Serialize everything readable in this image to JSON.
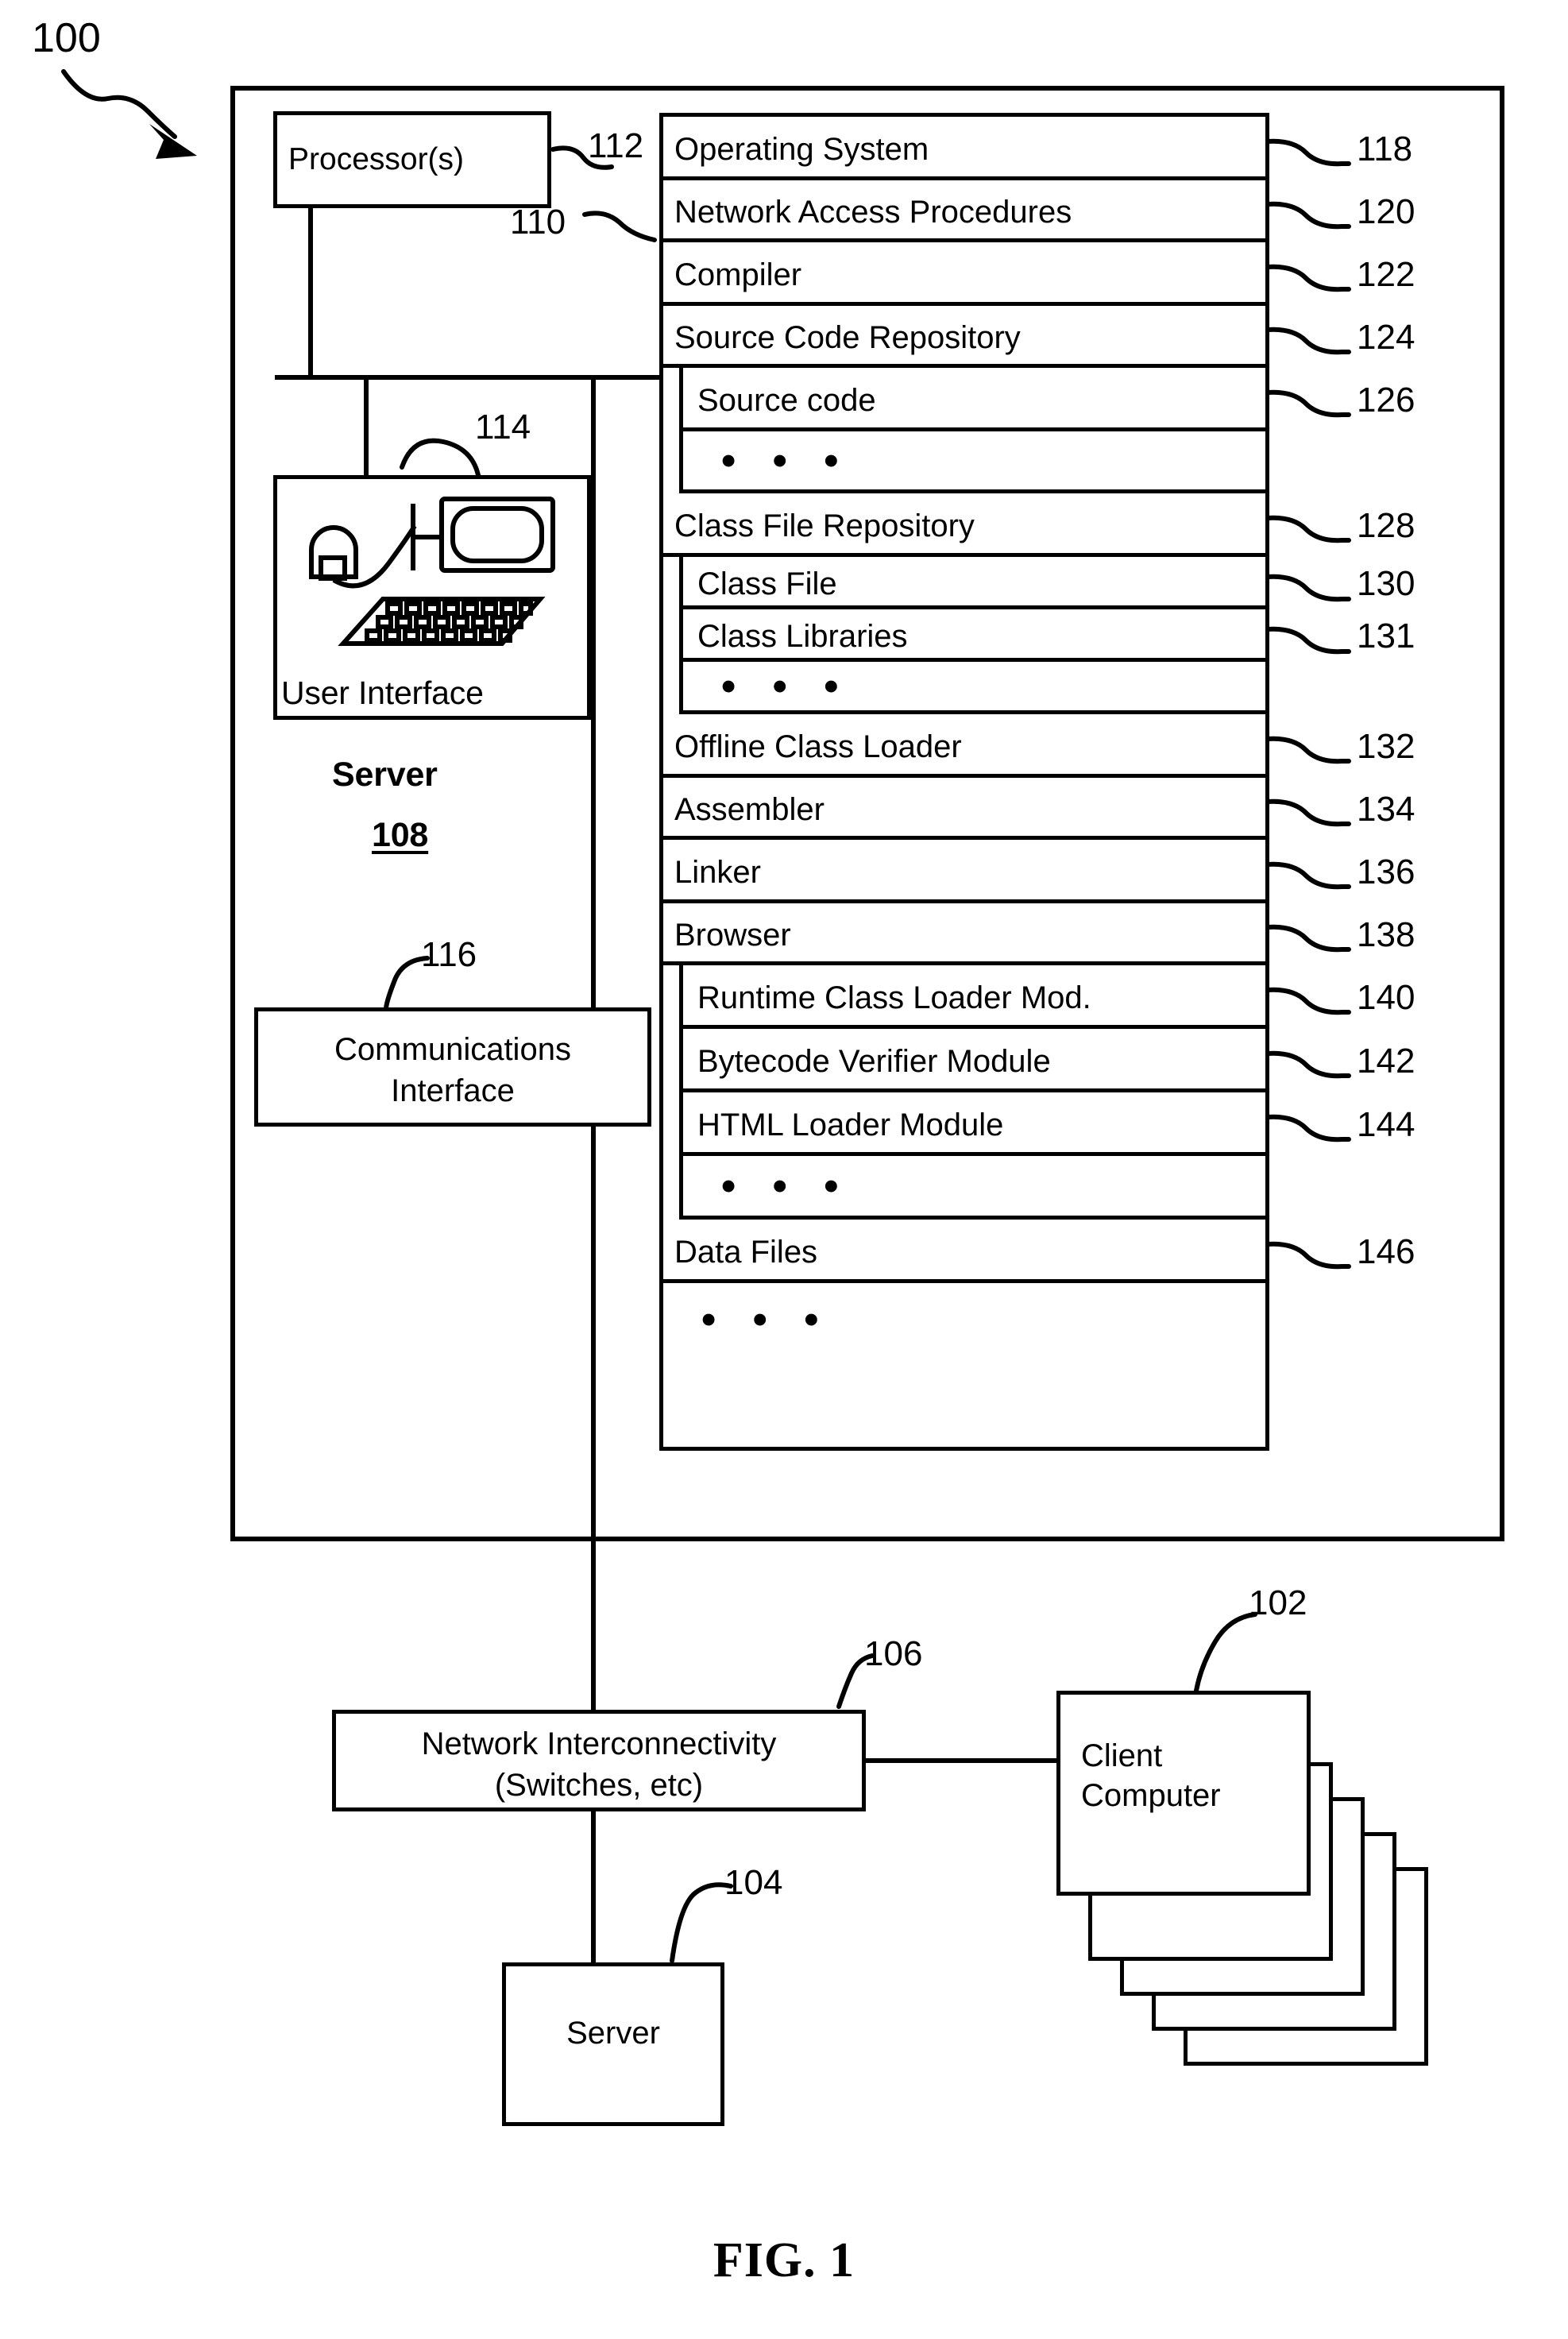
{
  "figure": {
    "caption": "FIG. 1",
    "system_ref": "100"
  },
  "server": {
    "title": "Server",
    "ref": "108",
    "processor": {
      "label": "Processor(s)",
      "ref": "112"
    },
    "user_interface": {
      "label": "User Interface",
      "ref": "114",
      "icon": "desktop-computer-icon"
    },
    "communications_interface": {
      "line1": "Communications",
      "line2": "Interface",
      "ref": "116"
    },
    "memory_ref": "110"
  },
  "modules": [
    {
      "label": "Operating System",
      "ref": "118",
      "level": 0,
      "kind": "text"
    },
    {
      "label": "Network Access Procedures",
      "ref": "120",
      "level": 0,
      "kind": "text"
    },
    {
      "label": "Compiler",
      "ref": "122",
      "level": 0,
      "kind": "text"
    },
    {
      "label": "Source Code Repository",
      "ref": "124",
      "level": 0,
      "kind": "text"
    },
    {
      "label": "Source  code",
      "ref": "126",
      "level": 1,
      "kind": "text"
    },
    {
      "label": "• • •",
      "ref": "",
      "level": 1,
      "kind": "dots"
    },
    {
      "label": "Class File Repository",
      "ref": "128",
      "level": 0,
      "kind": "text"
    },
    {
      "label": "Class File",
      "ref": "130",
      "level": 1,
      "kind": "text"
    },
    {
      "label": "Class Libraries",
      "ref": "131",
      "level": 1,
      "kind": "text"
    },
    {
      "label": "• • •",
      "ref": "",
      "level": 1,
      "kind": "dots"
    },
    {
      "label": "Offline Class Loader",
      "ref": "132",
      "level": 0,
      "kind": "text"
    },
    {
      "label": "Assembler",
      "ref": "134",
      "level": 0,
      "kind": "text"
    },
    {
      "label": "Linker",
      "ref": "136",
      "level": 0,
      "kind": "text"
    },
    {
      "label": "Browser",
      "ref": "138",
      "level": 0,
      "kind": "text"
    },
    {
      "label": "Runtime Class Loader Mod.",
      "ref": "140",
      "level": 1,
      "kind": "text"
    },
    {
      "label": "Bytecode Verifier Module",
      "ref": "142",
      "level": 1,
      "kind": "text"
    },
    {
      "label": "HTML Loader Module",
      "ref": "144",
      "level": 1,
      "kind": "text"
    },
    {
      "label": "• • •",
      "ref": "",
      "level": 1,
      "kind": "dots"
    },
    {
      "label": "Data Files",
      "ref": "146",
      "level": 0,
      "kind": "text"
    },
    {
      "label": "• • •",
      "ref": "",
      "level": 0,
      "kind": "dots"
    }
  ],
  "network": {
    "line1": "Network Interconnectivity",
    "line2": "(Switches, etc)",
    "ref": "106"
  },
  "client": {
    "line1": "Client",
    "line2": "Computer",
    "ref": "102",
    "stack_count": 5
  },
  "bottom_server": {
    "label": "Server",
    "ref": "104"
  }
}
